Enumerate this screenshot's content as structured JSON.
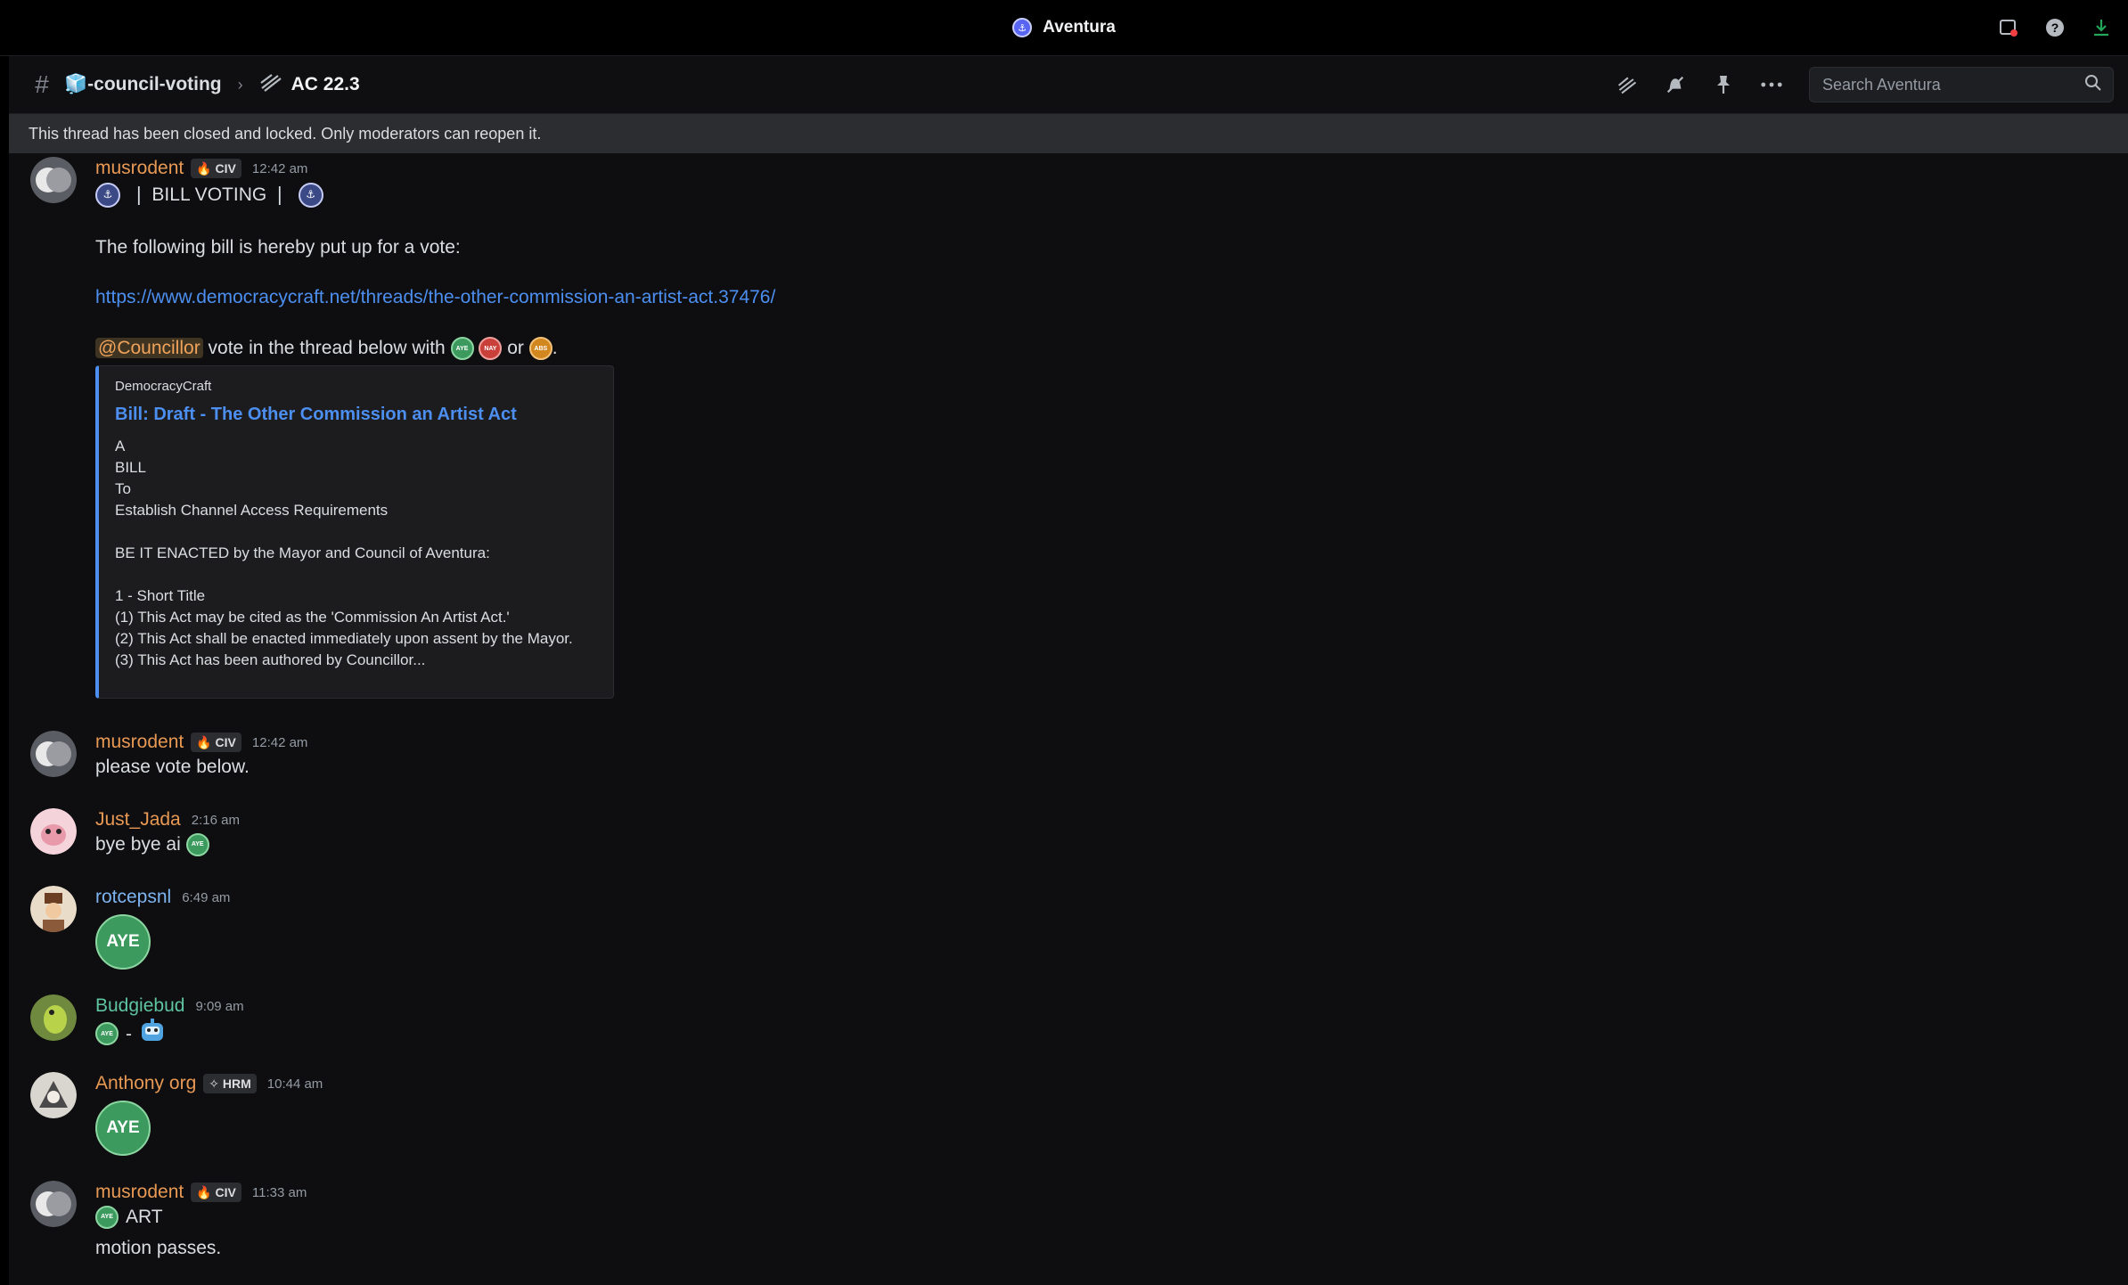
{
  "titlebar": {
    "server_abbr": "⚓",
    "title": "Aventura"
  },
  "header": {
    "channel": "🧊-council-voting",
    "thread": "AC 22.3",
    "search_placeholder": "Search Aventura"
  },
  "banner": {
    "text": "This thread has been closed and locked. Only moderators can reopen it."
  },
  "messages": [
    {
      "author": "musrodent",
      "tag": "🔥 CIV",
      "time": "12:42 am",
      "heading": "❘ BILL VOTING ❘",
      "line1": "The following bill is hereby put up for a vote:",
      "url": "https://www.democracycraft.net/threads/the-other-commission-an-artist-act.37476/",
      "mention": "@Councillor",
      "vote_text": "vote in the thread below with",
      "or": "or",
      "period": ".",
      "embed": {
        "provider": "DemocracyCraft",
        "title": "Bill: Draft - The Other Commission an Artist Act",
        "description": "A\nBILL\nTo\nEstablish Channel Access Requirements\n\nBE IT ENACTED by the Mayor and Council of Aventura:\n\n1 - Short Title\n(1) This Act may be cited as the 'Commission An Artist Act.'\n(2) This Act shall be enacted immediately upon assent by the Mayor.\n(3) This Act has been authored by Councillor..."
      }
    },
    {
      "author": "musrodent",
      "tag": "🔥 CIV",
      "time": "12:42 am",
      "text": "please vote below."
    },
    {
      "author": "Just_Jada",
      "time": "2:16 am",
      "text": "bye bye ai"
    },
    {
      "author": "rotcepsnl",
      "time": "6:49 am"
    },
    {
      "author": "Budgiebud",
      "time": "9:09 am",
      "text": "-"
    },
    {
      "author": "Anthony org",
      "tag": "✧ HRM",
      "time": "10:44 am"
    },
    {
      "author": "musrodent",
      "tag": "🔥 CIV",
      "time": "11:33 am",
      "art": "ART",
      "text": "motion passes."
    }
  ],
  "emoji": {
    "aye": "AYE",
    "nay": "NAY",
    "abs": "ABS"
  },
  "colors": {
    "aye": "#3d9a5f",
    "nay": "#c9403b",
    "abs": "#d2861e",
    "link": "#4c8ff0",
    "username_orange": "#e89954"
  }
}
